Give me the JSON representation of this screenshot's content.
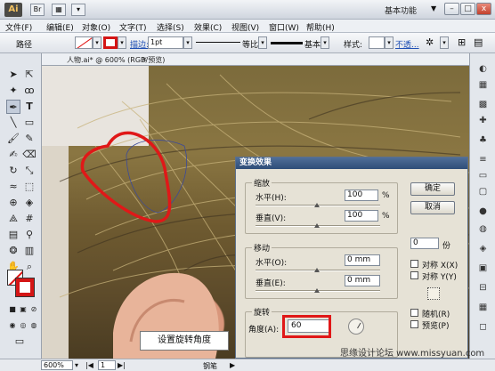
{
  "titlebar": {
    "app_logo": "Ai",
    "workspace": "基本功能",
    "workspace_arrow": "▼",
    "minimize": "–",
    "restore": "□",
    "close": "x"
  },
  "menubar": {
    "items": [
      "文件(F)",
      "编辑(E)",
      "对象(O)",
      "文字(T)",
      "选择(S)",
      "效果(C)",
      "视图(V)",
      "窗口(W)",
      "帮助(H)"
    ]
  },
  "controlbar": {
    "object_type": "路径",
    "stroke_label": "描边:",
    "stroke_weight": "1pt",
    "profile_label": "等比",
    "brush_label": "基本",
    "style_label": "样式:",
    "opacity_link": "不透...",
    "colors": {
      "stroke": "#d41515"
    }
  },
  "document": {
    "tab_label": "人物.ai* @ 600% (RGB/预览)",
    "tab_close": "×",
    "caption": "设置旋转角度"
  },
  "statusbar": {
    "zoom": "600%",
    "page": "1",
    "tool_name": "钢笔"
  },
  "watermark": "思缘设计论坛 www.missyuan.com",
  "dialog": {
    "title": "变换效果",
    "scale": {
      "label": "缩放",
      "horizontal_label": "水平(H):",
      "horizontal_value": "100",
      "vertical_label": "垂直(V):",
      "vertical_value": "100",
      "unit": "%"
    },
    "move": {
      "label": "移动",
      "horizontal_label": "水平(O):",
      "horizontal_value": "0 mm",
      "vertical_label": "垂直(E):",
      "vertical_value": "0 mm"
    },
    "rotate": {
      "label": "旋转",
      "angle_label": "角度(A):",
      "angle_value": "60"
    },
    "ok_label": "确定",
    "cancel_label": "取消",
    "copies_value": "0",
    "copies_unit": "份",
    "reflect_x": "对称 X(X)",
    "reflect_y": "对称 Y(Y)",
    "random": "随机(R)",
    "preview": "预览(P)"
  }
}
